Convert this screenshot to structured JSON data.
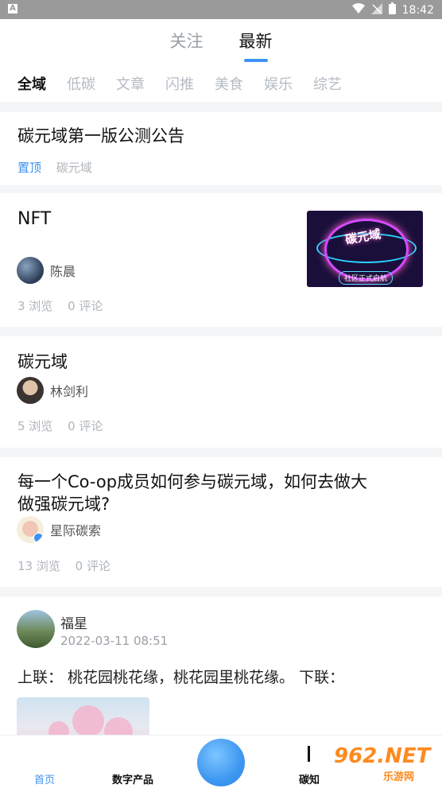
{
  "status_bar": {
    "time": "18:42",
    "app_badge": "A"
  },
  "top_tabs": [
    {
      "label": "关注"
    },
    {
      "label": "最新"
    }
  ],
  "categories": [
    {
      "label": "全域"
    },
    {
      "label": "低碳"
    },
    {
      "label": "文章"
    },
    {
      "label": "闪推"
    },
    {
      "label": "美食"
    },
    {
      "label": "娱乐"
    },
    {
      "label": "综艺"
    }
  ],
  "feed": [
    {
      "title": "碳元域第一版公测公告",
      "pinned": "置顶",
      "source": "碳元域"
    },
    {
      "title": "NFT",
      "author": "陈晨",
      "views": "3 浏览",
      "comments": "0 评论",
      "thumb_text": "碳元域",
      "thumb_sub": "社区正式启航"
    },
    {
      "title": "碳元域",
      "author": "林剑利",
      "views": "5 浏览",
      "comments": "0 评论"
    },
    {
      "title_line1": "每一个Co-op成员如何参与碳元域，如何去做大",
      "title_line2": "做强碳元域?",
      "author": "星际碳索",
      "views": "13 浏览",
      "comments": "0 评论"
    },
    {
      "author": "福星",
      "time": "2022-03-11 08:51",
      "body": "上联： 桃花园桃花缘，桃花园里桃花缘。 下联："
    }
  ],
  "bottom_nav": [
    {
      "label": "首页"
    },
    {
      "label": "数字产品"
    },
    {
      "label": "碳知"
    }
  ],
  "watermark": {
    "main": "962.NET",
    "sub": "乐游网"
  },
  "colors": {
    "accent": "#3c93f2",
    "muted": "#b0b5bb"
  }
}
